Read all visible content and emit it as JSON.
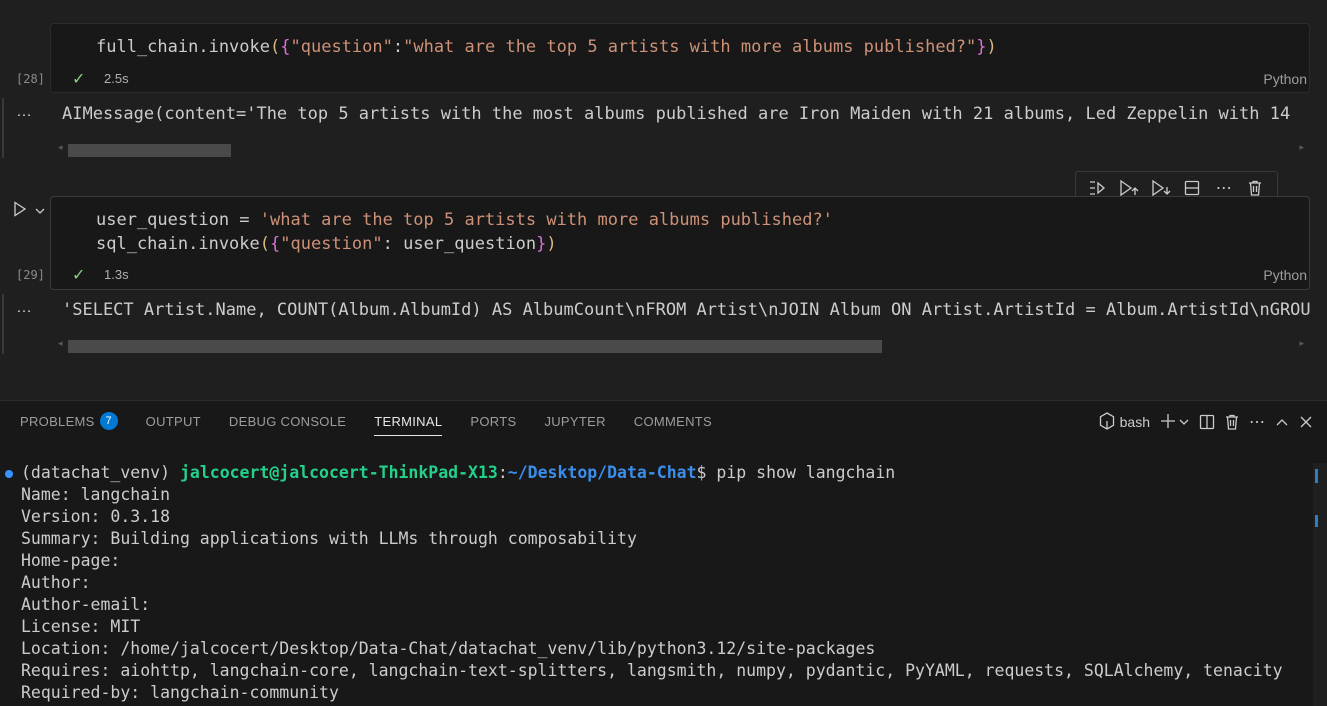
{
  "cells": [
    {
      "execution_count": "[28]",
      "code_lines": [
        [
          {
            "t": "full_chain.invoke",
            "c": "fn"
          },
          {
            "t": "(",
            "c": "paren"
          },
          {
            "t": "{",
            "c": "brace"
          },
          {
            "t": "\"question\"",
            "c": "str"
          },
          {
            "t": ":",
            "c": "fn"
          },
          {
            "t": "\"what are the top 5 artists with more albums published?\"",
            "c": "str"
          },
          {
            "t": "}",
            "c": "brace"
          },
          {
            "t": ")",
            "c": "paren"
          }
        ]
      ],
      "duration": "2.5s",
      "language": "Python",
      "output_prefix": "…",
      "output": "AIMessage(content='The top 5 artists with the most albums published are Iron Maiden with 21 albums, Led Zeppelin with 14"
    },
    {
      "execution_count": "[29]",
      "code_lines": [
        [
          {
            "t": "user_question = ",
            "c": "fn"
          },
          {
            "t": "'what are the top 5 artists with more albums published?'",
            "c": "str"
          }
        ],
        [
          {
            "t": "sql_chain.invoke",
            "c": "fn"
          },
          {
            "t": "(",
            "c": "paren"
          },
          {
            "t": "{",
            "c": "brace"
          },
          {
            "t": "\"question\"",
            "c": "str"
          },
          {
            "t": ": user_question",
            "c": "fn"
          },
          {
            "t": "}",
            "c": "brace"
          },
          {
            "t": ")",
            "c": "paren"
          }
        ]
      ],
      "duration": "1.3s",
      "language": "Python",
      "output_prefix": "…",
      "output": "'SELECT Artist.Name, COUNT(Album.AlbumId) AS AlbumCount\\nFROM Artist\\nJOIN Album ON Artist.ArtistId = Album.ArtistId\\nGROUP BY"
    }
  ],
  "cell_toolbar": [
    "run-by-line-icon",
    "execute-above-icon",
    "execute-below-icon",
    "split-cell-icon",
    "more-icon",
    "trash-icon"
  ],
  "panel": {
    "tabs": [
      {
        "label": "PROBLEMS",
        "badge": "7",
        "active": false
      },
      {
        "label": "OUTPUT",
        "active": false
      },
      {
        "label": "DEBUG CONSOLE",
        "active": false
      },
      {
        "label": "TERMINAL",
        "active": true
      },
      {
        "label": "PORTS",
        "active": false
      },
      {
        "label": "JUPYTER",
        "active": false
      },
      {
        "label": "COMMENTS",
        "active": false
      }
    ],
    "terminal_name": "bash"
  },
  "terminal": {
    "prompt": {
      "venv": "(datachat_venv) ",
      "user": "jalcocert@jalcocert-ThinkPad-X13",
      "sep": ":",
      "path": "~/Desktop/Data-Chat",
      "dollar": "$ ",
      "command": "pip show langchain"
    },
    "lines": [
      "Name: langchain",
      "Version: 0.3.18",
      "Summary: Building applications with LLMs through composability",
      "Home-page: ",
      "Author: ",
      "Author-email: ",
      "License: MIT",
      "Location: /home/jalcocert/Desktop/Data-Chat/datachat_venv/lib/python3.12/site-packages",
      "Requires: aiohttp, langchain-core, langchain-text-splitters, langsmith, numpy, pydantic, PyYAML, requests, SQLAlchemy, tenacity",
      "Required-by: langchain-community"
    ]
  },
  "colors": {
    "accent": "#0078d4",
    "success": "#89d185",
    "string": "#ce9178",
    "user": "#23d18b",
    "path": "#3b8eea"
  }
}
